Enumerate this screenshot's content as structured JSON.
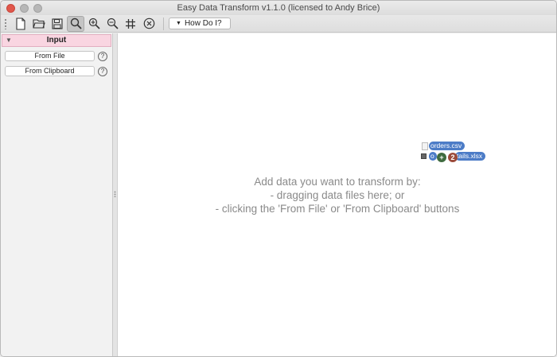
{
  "window": {
    "title": "Easy Data Transform v1.1.0 (licensed to Andy Brice)"
  },
  "toolbar": {
    "icons": [
      "new-file-icon",
      "open-folder-icon",
      "save-icon",
      "search-icon",
      "zoom-in-icon",
      "zoom-out-icon",
      "grid-icon",
      "close-circle-icon"
    ],
    "how_do_i_label": "How Do I?"
  },
  "left_panel": {
    "section_title": "Input",
    "items": [
      {
        "label": "From File",
        "help": "?"
      },
      {
        "label": "From Clipboard",
        "help": "?"
      }
    ],
    "colors": {
      "section_bg": "#f9d5e1"
    }
  },
  "canvas": {
    "hint_lines": [
      "Add data you want to transform by:",
      "- dragging data files here; or",
      "- clicking the 'From File' or 'From Clipboard' buttons"
    ],
    "drag": {
      "files": [
        "orders.csv",
        "order-details.xlsx"
      ],
      "visible_file_2_prefix": "o",
      "visible_file_2_suffix": "tails.xlsx",
      "count": "2",
      "plus": "+",
      "colors": {
        "file_label": "#4c7cc7",
        "plus_badge": "#3f6b3f",
        "count_badge": "#9b4a3a"
      }
    }
  }
}
